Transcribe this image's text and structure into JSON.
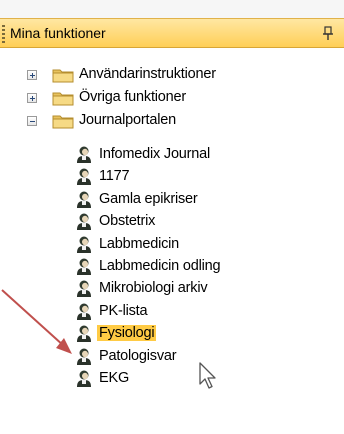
{
  "panel": {
    "title": "Mina funktioner",
    "pin_icon": "pin-icon"
  },
  "tree": {
    "folders": [
      {
        "label": "Användarinstruktioner",
        "expanded": false
      },
      {
        "label": "Övriga funktioner",
        "expanded": false
      },
      {
        "label": "Journalportalen",
        "expanded": true
      }
    ],
    "journal_items": [
      {
        "label": "Infomedix Journal",
        "selected": false
      },
      {
        "label": "1177",
        "selected": false
      },
      {
        "label": "Gamla epikriser",
        "selected": false
      },
      {
        "label": "Obstetrix",
        "selected": false
      },
      {
        "label": "Labbmedicin",
        "selected": false
      },
      {
        "label": "Labbmedicin odling",
        "selected": false
      },
      {
        "label": "Mikrobiologi arkiv",
        "selected": false
      },
      {
        "label": "PK-lista",
        "selected": false
      },
      {
        "label": "Fysiologi",
        "selected": true
      },
      {
        "label": "Patologisvar",
        "selected": false
      },
      {
        "label": "EKG",
        "selected": false
      }
    ]
  },
  "colors": {
    "header_top": "#ffe7a2",
    "header_bottom": "#ffcf57",
    "selection": "#ffcb45",
    "annotation_arrow": "#c0504d"
  }
}
